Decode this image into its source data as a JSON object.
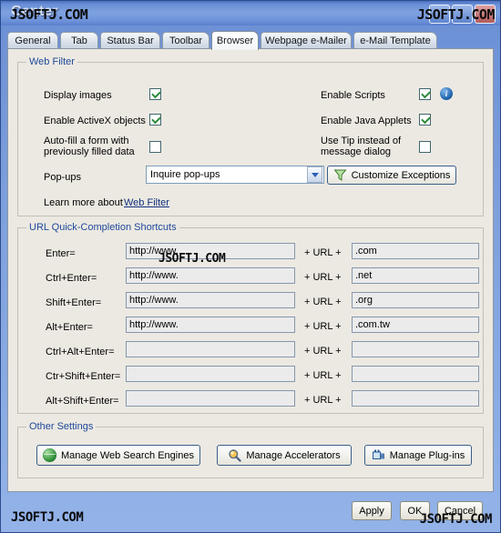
{
  "window": {
    "title": "Center",
    "watermark": "JSOFTJ.COM",
    "caption_buttons": [
      "minimize",
      "maximize",
      "close"
    ]
  },
  "tabs": [
    {
      "label": "General",
      "selected": false
    },
    {
      "label": "Tab",
      "selected": false
    },
    {
      "label": "Status Bar",
      "selected": false
    },
    {
      "label": "Toolbar",
      "selected": false
    },
    {
      "label": "Browser",
      "selected": true
    },
    {
      "label": "Webpage e-Mailer",
      "selected": false
    },
    {
      "label": "e-Mail Template",
      "selected": false
    }
  ],
  "web_filter": {
    "group_title": "Web Filter",
    "left_options": [
      {
        "label": "Display images",
        "checked": true
      },
      {
        "label": "Enable ActiveX objects",
        "checked": true
      },
      {
        "label": "Auto-fill a form with previously filled data",
        "checked": false
      }
    ],
    "right_options": [
      {
        "label": "Enable Scripts",
        "checked": true,
        "info": true
      },
      {
        "label": "Enable Java Applets",
        "checked": true,
        "info": false
      },
      {
        "label": "Use Tip instead of message dialog",
        "checked": false,
        "info": false
      }
    ],
    "popups_label": "Pop-ups",
    "popups_value": "Inquire pop-ups",
    "popups_options": [
      "Inquire pop-ups"
    ],
    "customize_button": "Customize Exceptions",
    "customize_icon": "funnel-icon",
    "learn_more_prefix": "Learn more about",
    "learn_more_link": "Web Filter"
  },
  "url_shortcuts": {
    "group_title": "URL Quick-Completion Shortcuts",
    "separator": "+ URL +",
    "rows": [
      {
        "key": "Enter=",
        "prefix": "http://www.",
        "suffix": ".com"
      },
      {
        "key": "Ctrl+Enter=",
        "prefix": "http://www.",
        "suffix": ".net"
      },
      {
        "key": "Shift+Enter=",
        "prefix": "http://www.",
        "suffix": ".org"
      },
      {
        "key": "Alt+Enter=",
        "prefix": "http://www.",
        "suffix": ".com.tw"
      },
      {
        "key": "Ctrl+Alt+Enter=",
        "prefix": "",
        "suffix": ""
      },
      {
        "key": "Ctr+Shift+Enter=",
        "prefix": "",
        "suffix": ""
      },
      {
        "key": "Alt+Shift+Enter=",
        "prefix": "",
        "suffix": ""
      }
    ]
  },
  "other_settings": {
    "group_title": "Other Settings",
    "buttons": [
      {
        "label": "Manage Web Search Engines",
        "icon": "globe-icon"
      },
      {
        "label": "Manage Accelerators",
        "icon": "magnifier-icon"
      },
      {
        "label": "Manage Plug-ins",
        "icon": "plugin-icon"
      }
    ]
  },
  "footer": {
    "apply": "Apply",
    "ok": "OK",
    "cancel": "Cancel",
    "watermark_left": "JSOFTJ.COM",
    "watermark_right": "JSOFTJ.COM"
  },
  "colors": {
    "title_bar": "#6a8fd6",
    "group_title": "#20499b",
    "link": "#13307e",
    "checkbox_border": "#41666e",
    "check_mark": "#2f8b3c",
    "client_bg": "#ece9e2"
  }
}
